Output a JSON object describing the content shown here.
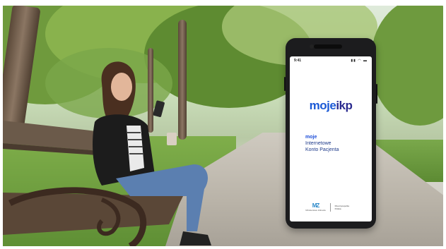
{
  "phone": {
    "status_time": "9:41",
    "status_icons": "▮▮ ◠ ▬",
    "app_logo_main": "moje",
    "app_logo_accent": "ikp",
    "tagline_bold": "moje",
    "tagline_line2": "Internetowe",
    "tagline_line3": "Konto Pacjenta",
    "ministry_mark": "MZ",
    "ministry_text": "Ministerstwo Zdrowia",
    "eu_text": "Rzeczpospolita Polska"
  },
  "colors": {
    "brand_blue": "#1b59d6",
    "phone_body": "#1c1c1e"
  }
}
